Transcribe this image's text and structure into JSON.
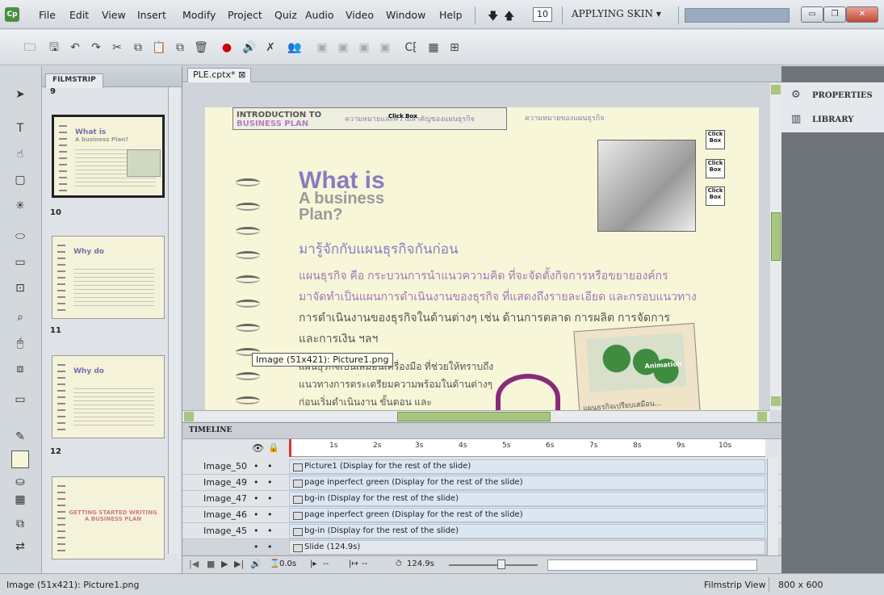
{
  "menubar": {
    "logo": "Cp",
    "items": [
      "File",
      "Edit",
      "View",
      "Insert",
      "Modify",
      "Project",
      "Quiz",
      "Audio",
      "Video",
      "Window",
      "Help"
    ],
    "slide_number": "10",
    "skin_label": "APPLYING SKIN ▾"
  },
  "window_buttons": [
    "minimize",
    "restore",
    "close"
  ],
  "filmstrip": {
    "title": "FILMSTRIP",
    "top_number": "9",
    "slides": [
      {
        "num": "10",
        "title": "What is",
        "subtitle": "A business Plan?"
      },
      {
        "num": "11",
        "title": "Why do",
        "subtitle": ""
      },
      {
        "num": "12",
        "title": "Why do",
        "subtitle": ""
      },
      {
        "num": "",
        "title": "",
        "subtitle": "GETTING STARTED WRITING A BUSINESS PLAN"
      }
    ]
  },
  "document_tab": "PLE.cptx*",
  "slide": {
    "nav_title_1": "INTRODUCTION TO",
    "nav_title_2": "BUSINESS PLAN",
    "nav_text_1": "ความหมายและความสำคัญของแผนธุรกิจ",
    "nav_text_2": "ความหมายของแผนธุรกิจ",
    "click_box": "Click Box",
    "heading_1": "What is",
    "heading_2": "A business",
    "heading_3": "Plan?",
    "subheading": "มารู้จักกับแผนธุรกิจกันก่อน",
    "para_1": "แผนธุรกิจ คือ กระบวนการนำแนวความคิด ที่จะจัดตั้งกิจการหรือขยายองค์กร",
    "para_2": "มาจัดทำเป็นแผนการดำเนินงานของธุรกิจ ที่แสดงถึงรายละเอียด และกรอบแนวทาง",
    "para_3": "การดำเนินงานของธุรกิจในด้านต่างๆ เช่น ด้านการตลาด การผลิต การจัดการ",
    "para_4": "และการเงิน ฯลฯ",
    "para_5": "แผนธุรกิจเป็นเสมือนเครื่องมือ ที่ช่วยให้ทราบถึง",
    "para_6": "แนวทางการตระเตรียมความพร้อมในด้านต่างๆ",
    "para_7": "ก่อนเริ่มดำเนินงาน ขั้นตอน และ",
    "animation_label": "Animation",
    "map_caption": "แผนธุรกิจเปรียบเสมือน..."
  },
  "tooltip": "Image (51x421): Picture1.png",
  "right_panel": {
    "properties": "PROPERTIES",
    "library": "LIBRARY"
  },
  "timeline": {
    "title": "TIMELINE",
    "ticks": [
      "1s",
      "2s",
      "3s",
      "4s",
      "5s",
      "6s",
      "7s",
      "8s",
      "9s",
      "10s"
    ],
    "rows": [
      {
        "name": "Image_50",
        "bar": "Picture1 (Display for the rest of the slide)"
      },
      {
        "name": "Image_49",
        "bar": "page inperfect green (Display for the rest of the slide)"
      },
      {
        "name": "Image_47",
        "bar": "bg-in (Display for the rest of the slide)"
      },
      {
        "name": "Image_46",
        "bar": "page inperfect green (Display for the rest of the slide)"
      },
      {
        "name": "Image_45",
        "bar": "bg-in (Display for the rest of the slide)"
      }
    ],
    "slide_row": "Slide (124.9s)",
    "time_current": "0.0s",
    "time_start": "--",
    "time_end": "--",
    "duration": "124.9s"
  },
  "statusbar": {
    "left": "Image (51x421): Picture1.png",
    "view": "Filmstrip View",
    "size": "800 x 600"
  }
}
